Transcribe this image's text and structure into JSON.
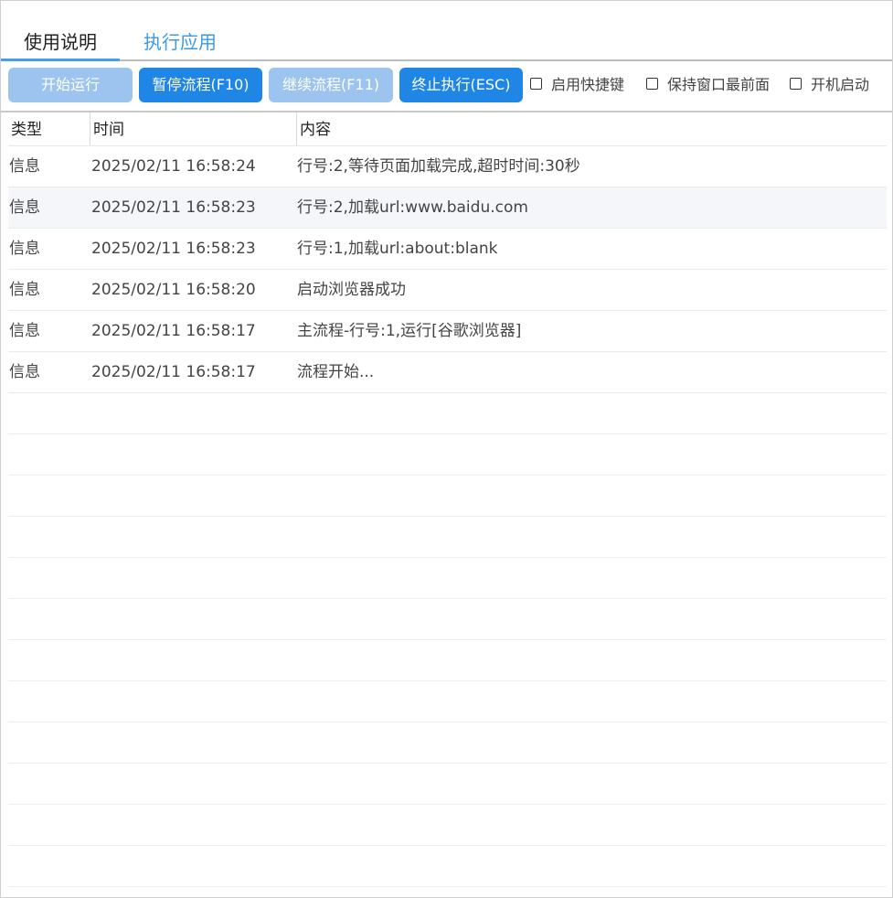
{
  "tabs": [
    {
      "label": "使用说明"
    },
    {
      "label": "执行应用"
    }
  ],
  "toolbar": {
    "start_label": "开始运行",
    "pause_label": "暂停流程(F10)",
    "resume_label": "继续流程(F11)",
    "stop_label": "终止执行(ESC)",
    "hotkeys_label": "启用快捷键",
    "ontop_label": "保持窗口最前面",
    "autostart_label": "开机启动"
  },
  "table": {
    "columns": [
      "类型",
      "时间",
      "内容"
    ],
    "rows": [
      {
        "type": "信息",
        "time": "2025/02/11 16:58:24",
        "message": "行号:2,等待页面加载完成,超时时间:30秒"
      },
      {
        "type": "信息",
        "time": "2025/02/11 16:58:23",
        "message": "行号:2,加载url:www.baidu.com"
      },
      {
        "type": "信息",
        "time": "2025/02/11 16:58:23",
        "message": "行号:1,加载url:about:blank"
      },
      {
        "type": "信息",
        "time": "2025/02/11 16:58:20",
        "message": "启动浏览器成功"
      },
      {
        "type": "信息",
        "time": "2025/02/11 16:58:17",
        "message": "主流程-行号:1,运行[谷歌浏览器]"
      },
      {
        "type": "信息",
        "time": "2025/02/11 16:58:17",
        "message": "流程开始..."
      }
    ]
  },
  "colors": {
    "accent": "#1f86e5",
    "accent_disabled": "#9cc4ef",
    "tab_active_indicator": "#4a9ee6",
    "row_highlight": "#f5f6f9"
  }
}
